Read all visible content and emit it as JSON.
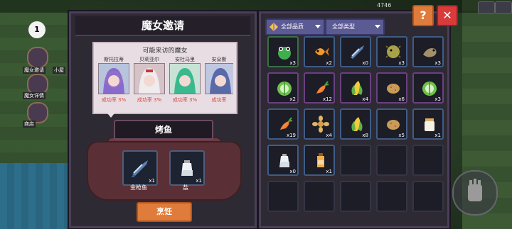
{
  "hud": {
    "coins": "4746",
    "chapter": "1"
  },
  "side_menu": [
    {
      "label": "魔女邀请"
    },
    {
      "label": "魔女详情"
    },
    {
      "label": "商店"
    }
  ],
  "side_top_label": "小屋",
  "left_panel": {
    "title": "魔女邀请",
    "subtitle": "可能来访的魔女",
    "witches": [
      {
        "name": "斯托拉蒂",
        "rate": "成功率 3%",
        "color": "#7f5bc9"
      },
      {
        "name": "贝莉亚尔",
        "rate": "成功率 3%",
        "color": "#d9d3d6"
      },
      {
        "name": "安杜马里",
        "rate": "成功率 3%",
        "color": "#3bb98e"
      },
      {
        "name": "安朵斯",
        "rate": "成功率",
        "color": "#5a6aa8"
      }
    ],
    "dish": "烤鱼",
    "ingredients": [
      {
        "name": "金枪鱼",
        "qty": "x1",
        "icon": "tuna-icon"
      },
      {
        "name": "盐",
        "qty": "x1",
        "icon": "salt-icon"
      }
    ],
    "cook_button": "烹饪"
  },
  "right_panel": {
    "filter_quality": "全部品质",
    "filter_type": "全部类型",
    "help": "?",
    "close": "✕",
    "items": [
      {
        "icon": "frog-icon",
        "qty": "x3",
        "frame": "green"
      },
      {
        "icon": "goldfish-icon",
        "qty": "x2",
        "frame": "blue"
      },
      {
        "icon": "tuna-icon",
        "qty": "x0",
        "frame": "blue"
      },
      {
        "icon": "pufferfish-icon",
        "qty": "x3",
        "frame": "blue"
      },
      {
        "icon": "seal-icon",
        "qty": "x3",
        "frame": "blue"
      },
      {
        "icon": "cabbage-icon",
        "qty": "x2",
        "frame": "purple"
      },
      {
        "icon": "carrot-icon",
        "qty": "x12",
        "frame": "purple"
      },
      {
        "icon": "corn-icon",
        "qty": "x4",
        "frame": "purple"
      },
      {
        "icon": "potato-icon",
        "qty": "x6",
        "frame": "purple"
      },
      {
        "icon": "cabbage-icon",
        "qty": "x3",
        "frame": "purple"
      },
      {
        "icon": "carrot-icon",
        "qty": "x19",
        "frame": "blue"
      },
      {
        "icon": "flower-icon",
        "qty": "x4",
        "frame": "blue"
      },
      {
        "icon": "corn-icon",
        "qty": "x8",
        "frame": "blue"
      },
      {
        "icon": "potato-icon",
        "qty": "x5",
        "frame": "blue"
      },
      {
        "icon": "jar-icon",
        "qty": "x1",
        "frame": "blue"
      },
      {
        "icon": "salt-icon",
        "qty": "x0",
        "frame": "blue"
      },
      {
        "icon": "oil-icon",
        "qty": "x1",
        "frame": "blue"
      },
      {
        "icon": "",
        "qty": "",
        "frame": "none"
      },
      {
        "icon": "",
        "qty": "",
        "frame": "none"
      },
      {
        "icon": "",
        "qty": "",
        "frame": "none"
      },
      {
        "icon": "",
        "qty": "",
        "frame": "none"
      },
      {
        "icon": "",
        "qty": "",
        "frame": "none"
      },
      {
        "icon": "",
        "qty": "",
        "frame": "none"
      },
      {
        "icon": "",
        "qty": "",
        "frame": "none"
      },
      {
        "icon": "",
        "qty": "",
        "frame": "none"
      }
    ]
  }
}
